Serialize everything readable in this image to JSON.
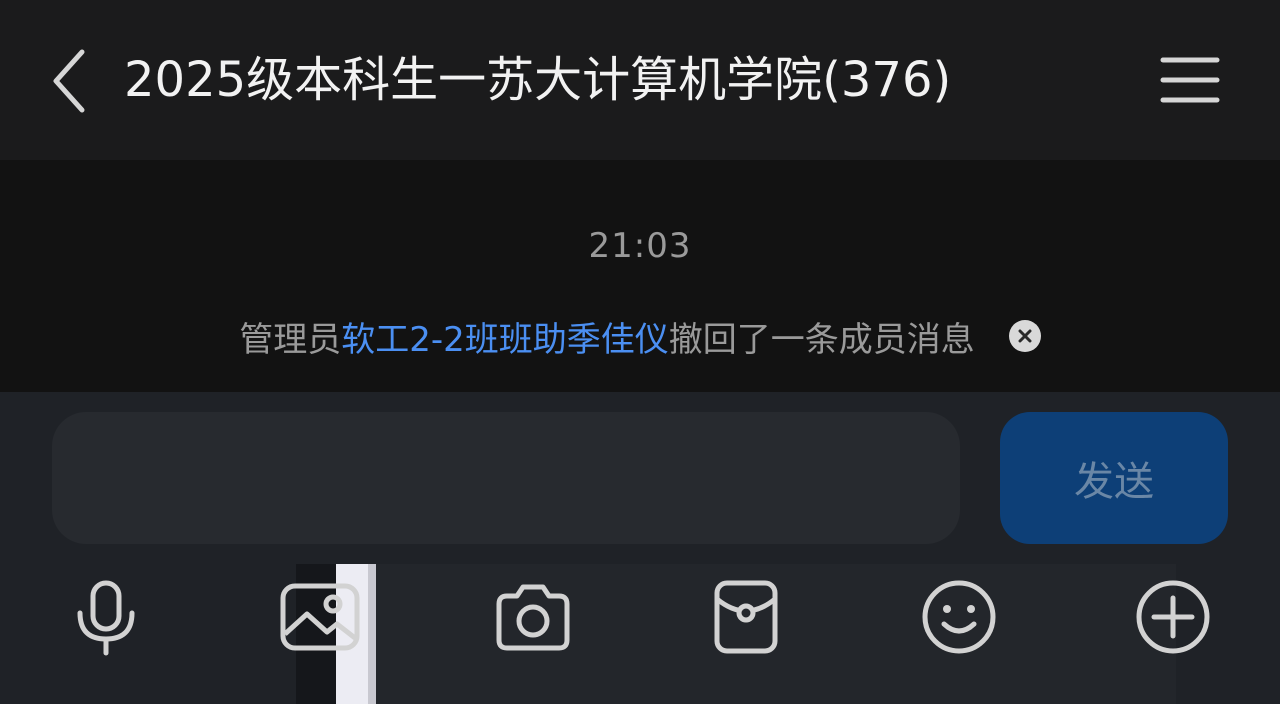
{
  "header": {
    "title": "2025级本科生一苏大计算机学院(376)",
    "back_icon": "chevron-left-icon",
    "menu_icon": "menu-icon"
  },
  "chat": {
    "time": "21:03",
    "notice": {
      "prefix": "管理员",
      "actor": "软工2-2班班助季佳仪",
      "suffix": "撤回了一条成员消息"
    }
  },
  "composer": {
    "input_value": "",
    "send_label": "发送"
  },
  "toolbar": {
    "icons": [
      "microphone-icon",
      "image-icon",
      "camera-icon",
      "red-packet-icon",
      "emoji-icon",
      "plus-icon"
    ]
  },
  "colors": {
    "accent_link": "#4b8ff2",
    "send_button": "#0d3f77",
    "header_bg": "#1b1b1c",
    "chat_bg": "#121212",
    "composer_bg": "#1f2227"
  }
}
